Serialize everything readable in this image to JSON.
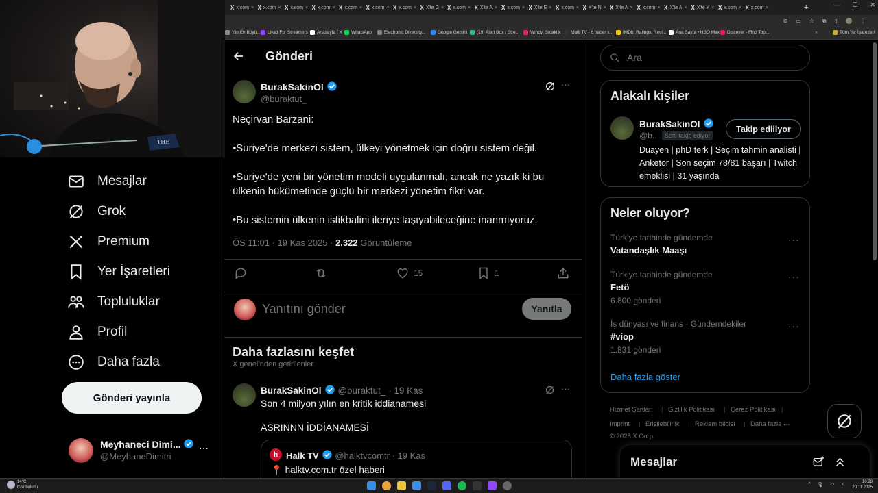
{
  "browser": {
    "tabs": [
      {
        "icon": "X",
        "label": "x.com"
      },
      {
        "icon": "X",
        "label": "x.com"
      },
      {
        "icon": "X",
        "label": "x.com"
      },
      {
        "icon": "X",
        "label": "x.com"
      },
      {
        "icon": "X",
        "label": "x.com"
      },
      {
        "icon": "X",
        "label": "x.com"
      },
      {
        "icon": "X",
        "label": "x.com"
      },
      {
        "icon": "X",
        "label": "X'te G"
      },
      {
        "icon": "X",
        "label": "x.com"
      },
      {
        "icon": "X",
        "label": "X'te A"
      },
      {
        "icon": "X",
        "label": "x.com"
      },
      {
        "icon": "X",
        "label": "X'te E"
      },
      {
        "icon": "X",
        "label": "x.com"
      },
      {
        "icon": "X",
        "label": "X'te N"
      },
      {
        "icon": "X",
        "label": "X'te A"
      },
      {
        "icon": "X",
        "label": "x.com"
      },
      {
        "icon": "X",
        "label": "X'te A"
      },
      {
        "icon": "X",
        "label": "X'te Y"
      },
      {
        "icon": "X",
        "label": "x.com"
      },
      {
        "icon": "X",
        "label": "x.com"
      }
    ],
    "bookmarks": [
      {
        "label": "'nin En Büyü...",
        "color": "#888"
      },
      {
        "label": "Livad For Streamers",
        "color": "#9146ff"
      },
      {
        "label": "Anasayfa / X",
        "color": "#fff"
      },
      {
        "label": "WhatsApp",
        "color": "#25d366"
      },
      {
        "label": "Electronic Diversity...",
        "color": "#888"
      },
      {
        "label": "Google Gemini",
        "color": "#4285f4"
      },
      {
        "label": "(19) Alert Box / Stre...",
        "color": "#31c3a2"
      },
      {
        "label": "Windy: Sıcaklık",
        "color": "#e0245e"
      },
      {
        "label": "Multi TV - 6 haber k...",
        "color": "#333"
      },
      {
        "label": "IMDb: Ratings, Revi...",
        "color": "#f5c518"
      },
      {
        "label": "Ana Sayfa • HBO Max",
        "color": "#fff"
      },
      {
        "label": "Discover - Find Top...",
        "color": "#e0245e"
      }
    ],
    "all_bookmarks": "Tüm Yer İşaretleri"
  },
  "sidebar": {
    "items": [
      {
        "label": "Mesajlar",
        "icon": "envelope-icon"
      },
      {
        "label": "Grok",
        "icon": "grok-icon"
      },
      {
        "label": "Premium",
        "icon": "x-logo-icon"
      },
      {
        "label": "Yer İşaretleri",
        "icon": "bookmark-icon"
      },
      {
        "label": "Topluluklar",
        "icon": "communities-icon"
      },
      {
        "label": "Profil",
        "icon": "person-icon"
      },
      {
        "label": "Daha fazla",
        "icon": "more-circle-icon"
      }
    ],
    "post_button": "Gönderi yayınla",
    "account": {
      "name": "Meyhaneci Dimi...",
      "handle": "@MeyhaneDimitri"
    }
  },
  "header": {
    "title": "Gönderi"
  },
  "post": {
    "author": "BurakSakinOl",
    "handle": "@buraktut_",
    "lines": [
      "Neçirvan Barzani:",
      "•Suriye'de merkezi sistem, ülkeyi yönetmek için doğru sistem değil.",
      "•Suriye'de yeni bir yönetim modeli uygulanmalı, ancak ne yazık ki bu ülkenin hükümetinde güçlü bir merkezi yönetim fikri var.",
      "•Bu sistemin ülkenin istikbalini ileriye taşıyabileceğine inanmıyoruz."
    ],
    "time": "ÖS 11:01 · 19 Kas 2025 · ",
    "views": "2.322",
    "views_label": " Görüntüleme",
    "likes": "15",
    "bookmarks": "1"
  },
  "reply": {
    "placeholder": "Yanıtını gönder",
    "button": "Yanıtla"
  },
  "discover": {
    "title": "Daha fazlasını keşfet",
    "subtitle": "X genelinden getirilenler",
    "tweet": {
      "author": "BurakSakinOl",
      "handle": "@buraktut_",
      "time": "· 19 Kas",
      "text1": "Son 4 milyon yılın en kritik iddianamesi",
      "text2": "ASRINNN İDDİANAMESİ",
      "quote": {
        "author": "Halk TV",
        "handle": "@halktvcomtr",
        "time": "· 19 Kas",
        "text": "halktv.com.tr özel haberi"
      }
    }
  },
  "right": {
    "search_placeholder": "Ara",
    "related": {
      "title": "Alakalı kişiler",
      "name": "BurakSakinOl",
      "handle": "@b...",
      "follows_you": "Seni takip ediyor",
      "follow_button": "Takip ediliyor",
      "bio": "Duayen | phD terk | Seçim tahmin analisti | Anketör | Son seçim 78/81 başarı | Twitch emeklisi | 31 yaşında"
    },
    "trends": {
      "title": "Neler oluyor?",
      "items": [
        {
          "context": "Türkiye tarihinde gündemde",
          "name": "Vatandaşlık Maaşı",
          "count": ""
        },
        {
          "context": "Türkiye tarihinde gündemde",
          "name": "Fetö",
          "count": "6.800 gönderi"
        },
        {
          "context": "İş dünyası ve finans · Gündemdekiler",
          "name": "#viop",
          "count": "1.831 gönderi"
        }
      ],
      "show_more": "Daha fazla göster"
    },
    "footer": [
      "Hizmet Şartları",
      "Gizlilik Politikası",
      "Çerez Politikası",
      "Imprint",
      "Erişilebilirlik",
      "Reklam bilgisi",
      "Daha fazla ···",
      "© 2025 X Corp."
    ],
    "messages_drawer": "Mesajlar"
  },
  "taskbar": {
    "weather_temp": "14°C",
    "weather_desc": "Çok bulutlu",
    "time": "10:28",
    "date": "20.11.2025"
  },
  "colors": {
    "accent": "#1d9bf0",
    "bg": "#000000",
    "border": "#2f3336",
    "muted": "#71767b"
  }
}
